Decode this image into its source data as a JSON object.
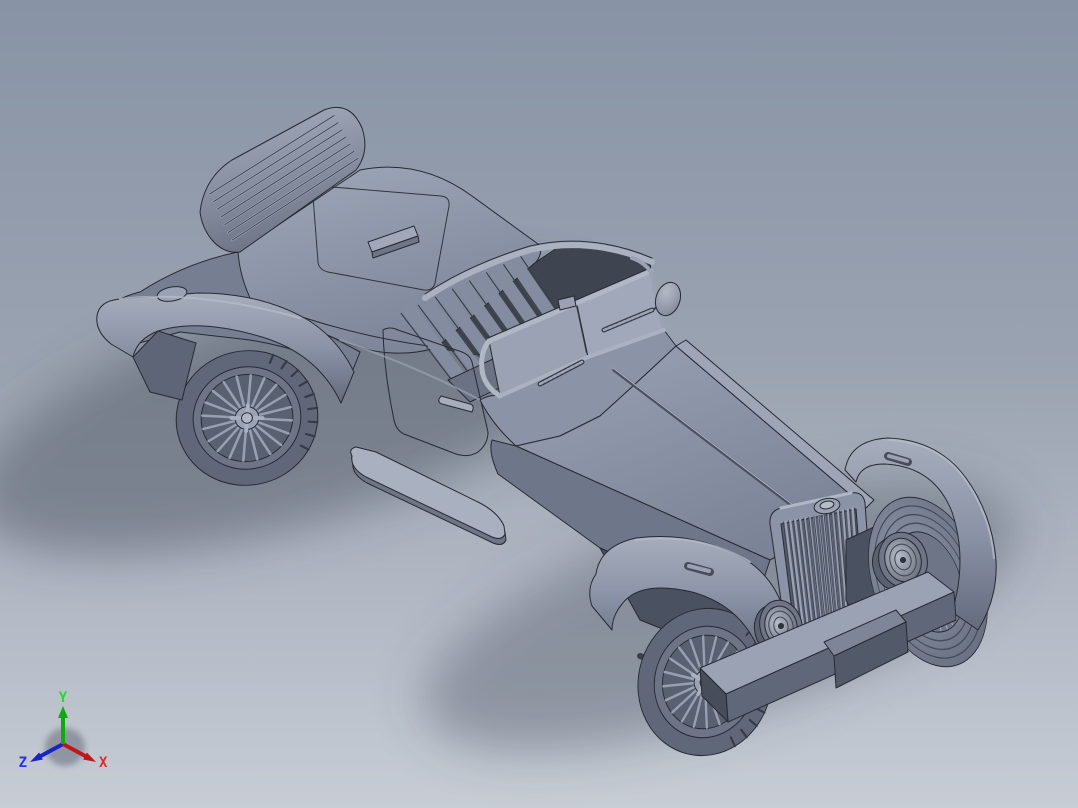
{
  "viewport": {
    "description": "Shaded-with-edges 3D CAD view of a vintage roadster car model",
    "background_top": "#8893a5",
    "background_mid": "#9aa3b1",
    "background_bottom": "#c7ccd5",
    "shadow_color": "#4e5663",
    "edge_color": "#262a33",
    "body_color": "#8a92a6"
  },
  "triad": {
    "x": {
      "label": "X",
      "label_color": "#e02828",
      "axis_color": "#c01818"
    },
    "y": {
      "label": "Y",
      "label_color": "#22dd22",
      "axis_color": "#12a812"
    },
    "z": {
      "label": "Z",
      "label_color": "#2a32e8",
      "axis_color": "#1a22c8"
    }
  }
}
